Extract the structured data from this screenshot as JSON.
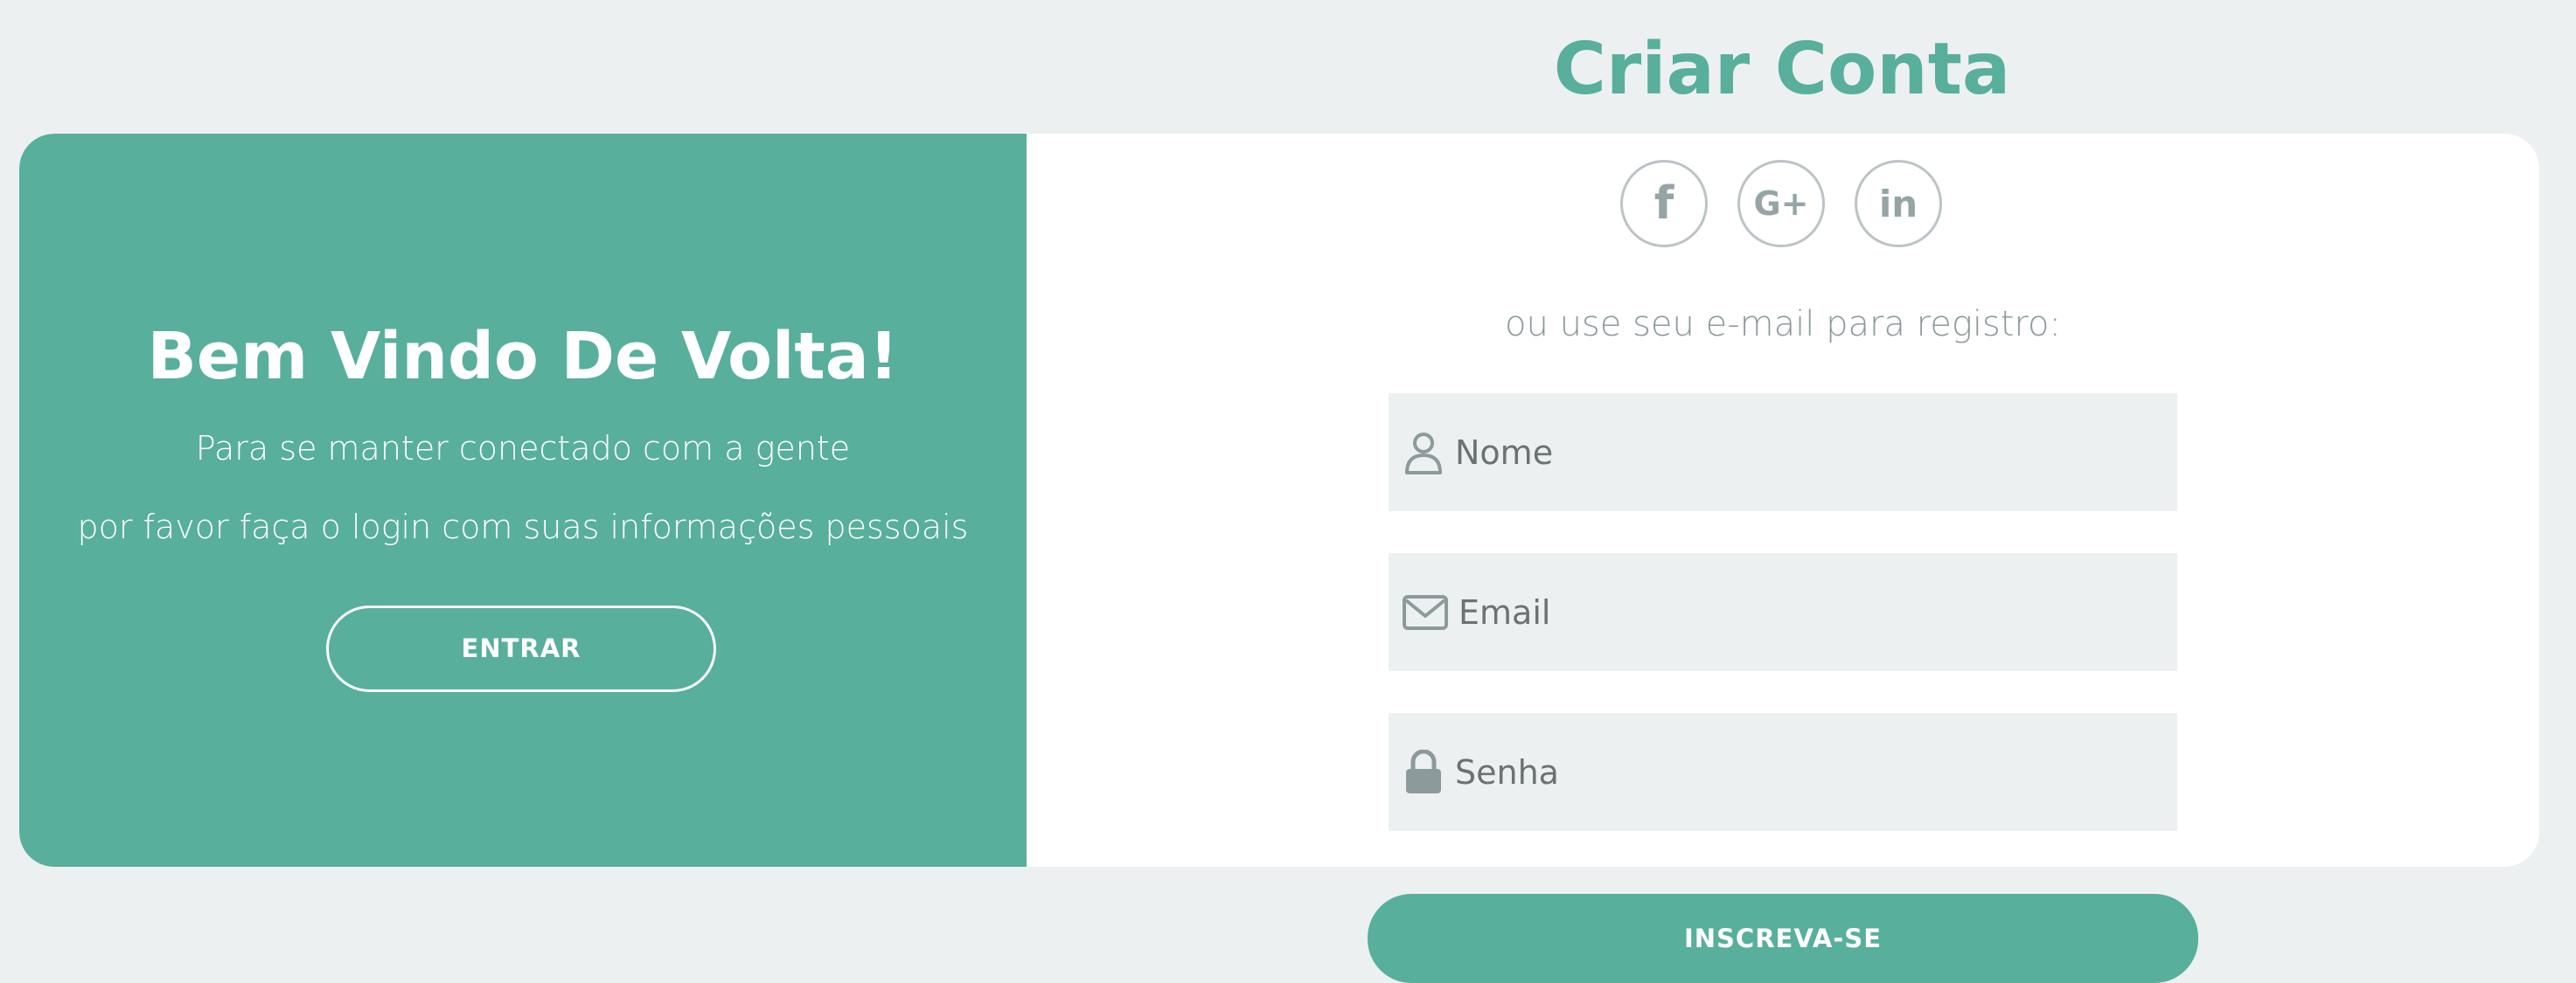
{
  "signup": {
    "title": "Criar Conta",
    "subtitle": "ou use seu e-mail para registro:",
    "button_label": "INSCREVA-SE",
    "social": [
      {
        "name": "facebook",
        "icon": "facebook-icon",
        "glyph": "f"
      },
      {
        "name": "google-plus",
        "icon": "google-plus-icon",
        "glyph": "G+"
      },
      {
        "name": "linkedin",
        "icon": "linkedin-icon",
        "glyph": "in"
      }
    ],
    "fields": {
      "name": {
        "placeholder": "Nome",
        "value": "",
        "icon": "user-icon"
      },
      "email": {
        "placeholder": "Email",
        "value": "",
        "icon": "envelope-icon"
      },
      "password": {
        "placeholder": "Senha",
        "value": "",
        "icon": "lock-icon"
      }
    }
  },
  "welcome": {
    "title": "Bem Vindo De Volta!",
    "line1": "Para se manter conectado com a gente",
    "line2": "por favor faça o login com suas informações pessoais",
    "button_label": "ENTRAR"
  },
  "colors": {
    "accent": "#58af9b",
    "page_bg": "#ecf0f1",
    "input_bg": "#ecf0f1",
    "muted_text": "#8d9a9c",
    "icon_gray": "#95a5a6"
  }
}
